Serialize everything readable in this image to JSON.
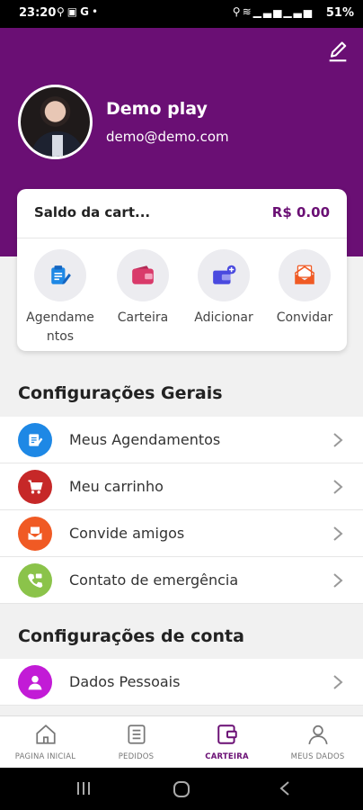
{
  "status_bar": {
    "time": "23:20",
    "battery": "51%",
    "left_icons": [
      "location-person-icon",
      "gallery-icon",
      "google-icon",
      "dot-icon"
    ],
    "right_icons": [
      "location-icon",
      "wifi-icon",
      "signal-icon",
      "signal-icon"
    ]
  },
  "profile": {
    "name": "Demo play",
    "email": "demo@demo.com",
    "edit_icon": "pencil-icon"
  },
  "wallet": {
    "balance_label": "Saldo da cart...",
    "balance_value": "R$ 0.00",
    "actions": [
      {
        "label": "Agendamentos",
        "icon": "schedule-icon",
        "color": "#1e88e5"
      },
      {
        "label": "Carteira",
        "icon": "wallet-icon",
        "color": "#d93a6a"
      },
      {
        "label": "Adicionar",
        "icon": "add-card-icon",
        "color": "#4a4adf"
      },
      {
        "label": "Convidar",
        "icon": "invite-icon",
        "color": "#f05a24"
      }
    ]
  },
  "general_settings": {
    "title": "Configurações Gerais",
    "items": [
      {
        "label": "Meus Agendamentos",
        "icon": "schedule-icon",
        "color": "#1e88e5"
      },
      {
        "label": "Meu carrinho",
        "icon": "cart-icon",
        "color": "#c62828"
      },
      {
        "label": "Convide amigos",
        "icon": "invite-icon",
        "color": "#f05a24"
      },
      {
        "label": "Contato de emergência",
        "icon": "phone-icon",
        "color": "#8bc34a"
      }
    ]
  },
  "account_settings": {
    "title": "Configurações de conta",
    "items": [
      {
        "label": "Dados Pessoais",
        "icon": "person-icon",
        "color": "#c21bd6"
      }
    ]
  },
  "bottom_nav": {
    "items": [
      {
        "label": "PAGINA INICIAL",
        "icon": "home-icon",
        "active": false
      },
      {
        "label": "PEDIDOS",
        "icon": "orders-icon",
        "active": false
      },
      {
        "label": "CARTEIRA",
        "icon": "wallet-icon",
        "active": true
      },
      {
        "label": "MEUS DADOS",
        "icon": "user-icon",
        "active": false
      }
    ]
  },
  "colors": {
    "brand": "#6a0f74",
    "background": "#f1f1f1"
  }
}
